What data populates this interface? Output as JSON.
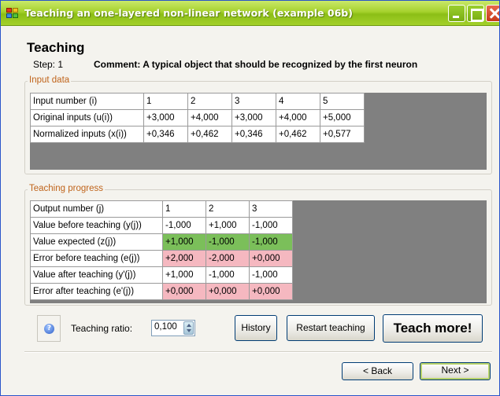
{
  "window": {
    "title": "Teaching an one-layered non-linear network (example 06b)"
  },
  "header": {
    "heading": "Teaching",
    "step_label": "Step: 1",
    "comment": "Comment: A typical object that should be recognized by the first neuron"
  },
  "input_data": {
    "legend": "Input data",
    "rows": [
      {
        "label": "Input number (i)",
        "cells": [
          "1",
          "2",
          "3",
          "4",
          "5"
        ]
      },
      {
        "label": "Original inputs (u(i))",
        "cells": [
          "+3,000",
          "+4,000",
          "+3,000",
          "+4,000",
          "+5,000"
        ]
      },
      {
        "label": "Normalized inputs (x(i))",
        "cells": [
          "+0,346",
          "+0,462",
          "+0,346",
          "+0,462",
          "+0,577"
        ]
      }
    ]
  },
  "teaching_progress": {
    "legend": "Teaching progress",
    "rows": [
      {
        "label": "Output number (j)",
        "cells": [
          "1",
          "2",
          "3"
        ]
      },
      {
        "label": "Value before teaching (y(j))",
        "cells": [
          "-1,000",
          "+1,000",
          "-1,000"
        ]
      },
      {
        "label": "Value expected (z(j))",
        "cells": [
          "+1,000",
          "-1,000",
          "-1,000"
        ]
      },
      {
        "label": "Error before teaching (e(j))",
        "cells": [
          "+2,000",
          "-2,000",
          "+0,000"
        ]
      },
      {
        "label": "Value after teaching (y'(j))",
        "cells": [
          "+1,000",
          "-1,000",
          "-1,000"
        ]
      },
      {
        "label": "Error after teaching (e'(j))",
        "cells": [
          "+0,000",
          "+0,000",
          "+0,000"
        ]
      }
    ],
    "colors": {
      "expected": "#7bbf5a",
      "error": "#f5b8c0"
    }
  },
  "controls": {
    "ratio_label": "Teaching ratio:",
    "ratio_value": "0,100",
    "history_label": "History",
    "restart_label": "Restart teaching",
    "teach_more_label": "Teach more!",
    "back_label": "< Back",
    "next_label": "Next >"
  },
  "icons": {
    "app": "network-app-icon",
    "help": "help-icon"
  }
}
